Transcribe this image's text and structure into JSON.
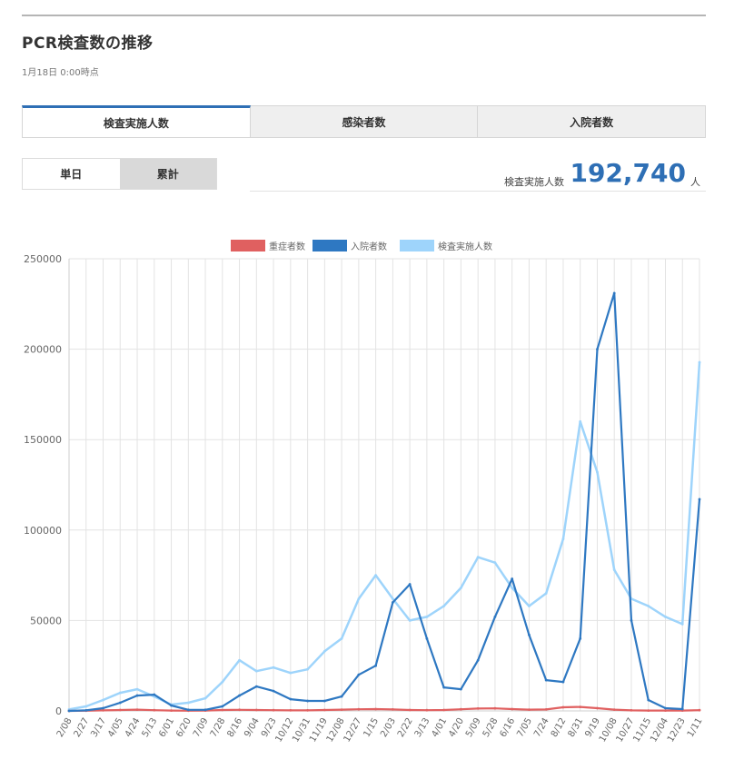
{
  "page": {
    "title": "PCR検査数の推移",
    "timestamp": "1月18日 0:00時点"
  },
  "tabs": [
    {
      "label": "検査実施人数",
      "active": true
    },
    {
      "label": "感染者数",
      "active": false
    },
    {
      "label": "入院者数",
      "active": false
    }
  ],
  "toggle": {
    "daily_label": "単日",
    "cumulative_label": "累計",
    "selected": "単日"
  },
  "summary": {
    "label": "検査実施人数",
    "value": "192,740",
    "unit": "人"
  },
  "colors": {
    "accent": "#2e6fb5",
    "severe": "#e06060",
    "hospitalized": "#2e78c2",
    "tests": "#9ed4fb"
  },
  "chart_data": {
    "type": "line",
    "title": "",
    "xlabel": "",
    "ylabel": "",
    "ylim": [
      0,
      250000
    ],
    "yticks": [
      0,
      50000,
      100000,
      150000,
      200000,
      250000
    ],
    "grid": true,
    "legend_position": "top-center",
    "x_tick_labels": [
      "2/08",
      "2/27",
      "3/17",
      "4/05",
      "4/24",
      "5/13",
      "6/01",
      "6/20",
      "7/09",
      "7/28",
      "8/16",
      "9/04",
      "9/23",
      "10/12",
      "10/31",
      "11/19",
      "12/08",
      "12/27",
      "1/15",
      "2/03",
      "2/22",
      "3/13",
      "4/01",
      "4/20",
      "5/09",
      "5/28",
      "6/16",
      "7/05",
      "7/24",
      "8/12",
      "8/31",
      "9/19",
      "10/08",
      "10/27",
      "11/15",
      "12/04",
      "12/23",
      "1/11"
    ],
    "series": [
      {
        "name": "重症者数",
        "color": "#e06060",
        "values": [
          0,
          100,
          300,
          500,
          700,
          400,
          200,
          100,
          200,
          500,
          600,
          500,
          400,
          300,
          300,
          500,
          700,
          900,
          1000,
          800,
          500,
          400,
          500,
          900,
          1300,
          1400,
          1000,
          700,
          800,
          2000,
          2200,
          1500,
          700,
          300,
          200,
          200,
          200,
          400
        ]
      },
      {
        "name": "入院者数",
        "color": "#2e78c2",
        "values": [
          0,
          300,
          1500,
          4500,
          8500,
          9000,
          3000,
          600,
          600,
          2500,
          8500,
          13500,
          11000,
          6500,
          5500,
          5500,
          8000,
          20000,
          25000,
          60000,
          70000,
          40000,
          13000,
          12000,
          28000,
          52000,
          73000,
          42000,
          17000,
          16000,
          40000,
          200000,
          231000,
          50000,
          6000,
          1500,
          1000,
          117000
        ]
      },
      {
        "name": "検査実施人数",
        "color": "#9ed4fb",
        "values": [
          800,
          2500,
          6000,
          10000,
          12000,
          8000,
          3500,
          4500,
          7000,
          16000,
          28000,
          22000,
          24000,
          21000,
          23000,
          33000,
          40000,
          62000,
          75000,
          62000,
          50000,
          52000,
          58000,
          68000,
          85000,
          82000,
          68000,
          58000,
          65000,
          95000,
          160000,
          132000,
          78000,
          62000,
          58000,
          52000,
          48000,
          192740
        ]
      }
    ]
  }
}
